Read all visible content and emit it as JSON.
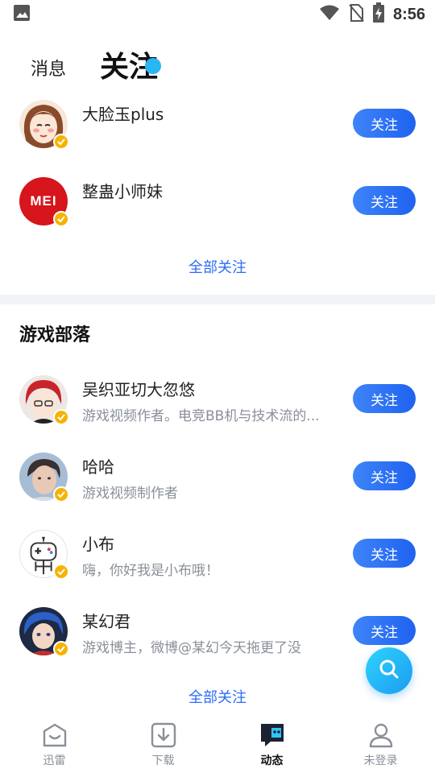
{
  "status_bar": {
    "time": "8:56"
  },
  "header": {
    "tab_messages": "消息",
    "tab_follow": "关注"
  },
  "recommended": {
    "users": [
      {
        "name": "大脸玉plus",
        "button": "关注"
      },
      {
        "name": "整蛊小师妹",
        "button": "关注",
        "avatar_text": "MEI"
      }
    ],
    "all_follow": "全部关注"
  },
  "game_tribe": {
    "title": "游戏部落",
    "users": [
      {
        "name": "吴织亚切大忽悠",
        "desc": "游戏视频作者。电竞BB机与技术流的...",
        "button": "关注"
      },
      {
        "name": "哈哈",
        "desc": "游戏视频制作者",
        "button": "关注"
      },
      {
        "name": "小布",
        "desc": "嗨，你好我是小布哦！",
        "button": "关注"
      },
      {
        "name": "某幻君",
        "desc": "游戏博主，微博@某幻今天拖更了没",
        "button": "关注"
      }
    ],
    "all_follow": "全部关注"
  },
  "bottom_nav": {
    "items": [
      {
        "label": "迅雷",
        "icon": "home-box-icon"
      },
      {
        "label": "下载",
        "icon": "download-icon"
      },
      {
        "label": "动态",
        "icon": "chat-bubble-icon",
        "active": true
      },
      {
        "label": "未登录",
        "icon": "user-icon"
      }
    ]
  },
  "colors": {
    "accent": "#1f62f0",
    "link": "#2d6cf5",
    "badge": "#f5b301",
    "fab": "#1a9bf0"
  }
}
